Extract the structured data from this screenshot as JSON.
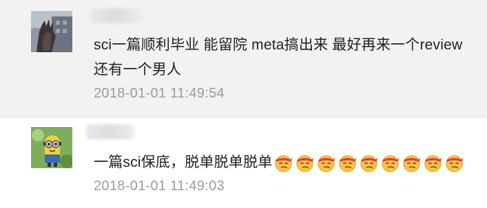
{
  "comments": [
    {
      "text": "sci一篇顺利毕业 能留院 meta搞出来 最好再来一个review还有一个男人",
      "timestamp": "2018-01-01 11:49:54"
    },
    {
      "text": "一篇sci保底，脱单脱单脱单",
      "emoji_icon": "smirk-face-emoji",
      "emoji_count": 9,
      "timestamp": "2018-01-01 11:49:03"
    }
  ],
  "colors": {
    "comment_bg_highlight": "#f2f2f2",
    "text": "#1f1f1f",
    "timestamp": "#9b9b9b"
  }
}
